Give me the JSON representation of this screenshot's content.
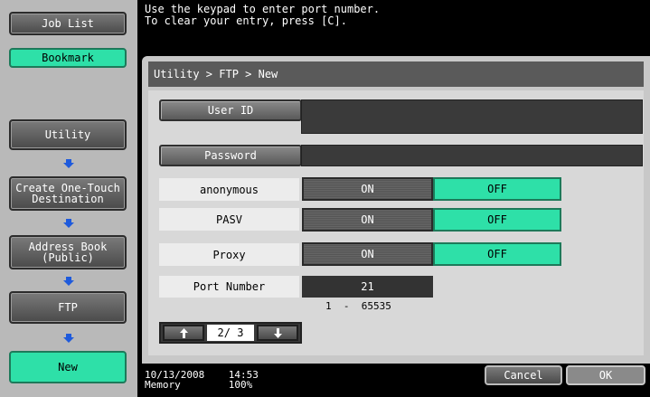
{
  "sidebar": {
    "job_list": "Job List",
    "bookmark": "Bookmark",
    "utility": "Utility",
    "create_one_touch_line1": "Create One-Touch",
    "create_one_touch_line2": "Destination",
    "address_book_line1": "Address Book",
    "address_book_line2": "(Public)",
    "ftp": "FTP",
    "new": "New"
  },
  "message": {
    "line1": "Use the keypad to enter port number.",
    "line2": "To clear your entry, press [C]."
  },
  "breadcrumb": "Utility > FTP > New",
  "form": {
    "user_id_label": "User ID",
    "user_id_value": "",
    "password_label": "Password",
    "password_value": "",
    "anonymous_label": "anonymous",
    "pasv_label": "PASV",
    "proxy_label": "Proxy",
    "on_label": "ON",
    "off_label": "OFF",
    "port_label": "Port Number",
    "port_value": "21",
    "port_range": "1  -  65535"
  },
  "pager": {
    "text": "2/ 3"
  },
  "status": {
    "date": "10/13/2008",
    "time": "14:53",
    "memory_label": "Memory",
    "memory_value": "100%"
  },
  "actions": {
    "cancel": "Cancel",
    "ok": "OK"
  },
  "colors": {
    "accent_green": "#2ee0a8",
    "nav_arrow_blue": "#1e5adc"
  }
}
